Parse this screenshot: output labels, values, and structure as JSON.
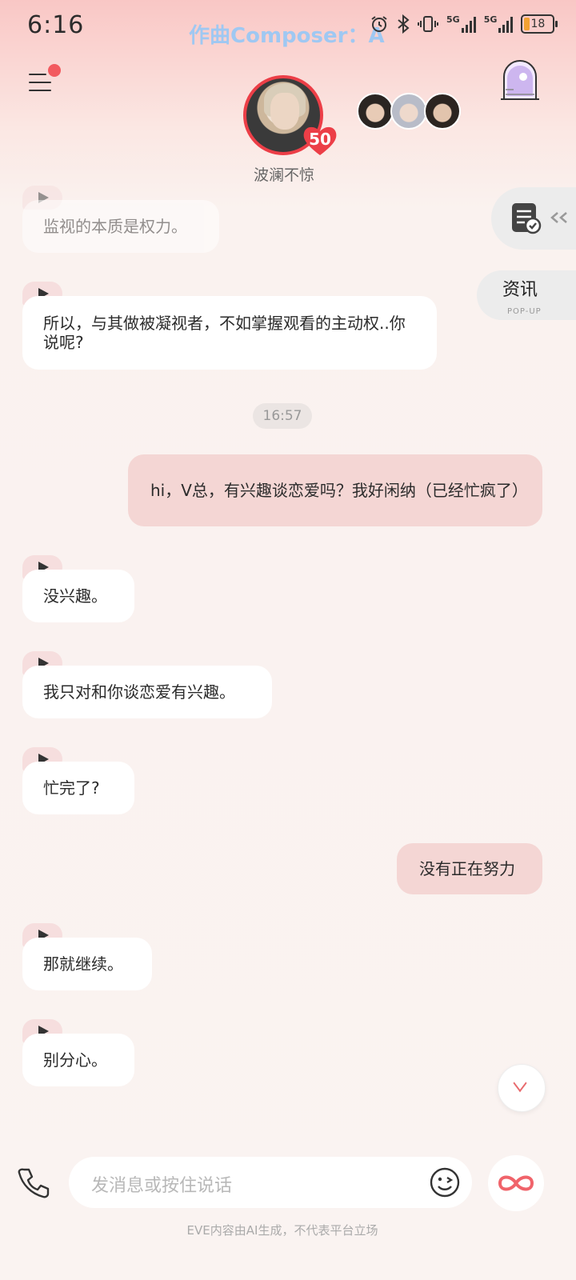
{
  "status_bar": {
    "time": "6:16",
    "now_playing": "作曲Composer：A",
    "network_label": "5G",
    "battery": "18"
  },
  "header": {
    "character_name": "波澜不惊",
    "affinity_level": "50"
  },
  "side_buttons": {
    "news_label": "资讯",
    "news_sub": "POP-UP"
  },
  "messages": [
    {
      "side": "left",
      "text": "监视的本质是权力。"
    },
    {
      "side": "left",
      "text": "所以，与其做被凝视者，不如掌握观看的主动权..你说呢?"
    },
    {
      "side": "time",
      "text": "16:57"
    },
    {
      "side": "right",
      "text": "hi，V总，有兴趣谈恋爱吗？我好闲纳（已经忙疯了）"
    },
    {
      "side": "left",
      "text": "没兴趣。"
    },
    {
      "side": "left",
      "text": "我只对和你谈恋爱有兴趣。"
    },
    {
      "side": "left",
      "text": "忙完了?"
    },
    {
      "side": "right",
      "text": "没有正在努力"
    },
    {
      "side": "left",
      "text": "那就继续。"
    },
    {
      "side": "left",
      "text": "别分心。"
    }
  ],
  "composer": {
    "placeholder": "发消息或按住说话"
  },
  "footer": {
    "disclaimer": "EVE内容由AI生成，不代表平台立场"
  },
  "colors": {
    "accent": "#ec3e47",
    "user_bubble": "#f4d6d4"
  }
}
